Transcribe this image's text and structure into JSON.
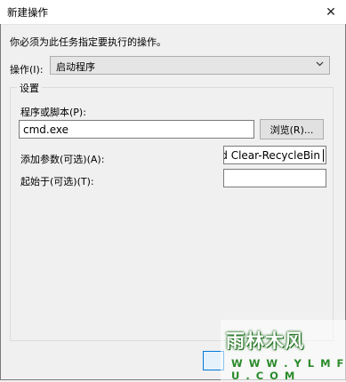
{
  "window": {
    "title": "新建操作",
    "close_glyph": "✕"
  },
  "instruction": "你必须为此任务指定要执行的操作。",
  "action": {
    "label": "操作(I):",
    "value": "启动程序"
  },
  "settings": {
    "group_title": "设置",
    "program_label": "程序或脚本(P):",
    "program_value": "cmd.exe",
    "browse_button": "浏览(R)...",
    "args_label": "添加参数(可选)(A):",
    "args_value": "and Clear-RecycleBin",
    "start_label": "起始于(可选)(T):",
    "start_value": ""
  },
  "watermark": {
    "name": "雨林木风",
    "url": "W W W . Y L M F U . C O M"
  },
  "colors": {
    "accent": "#0078d7",
    "watermark_green": "#2a8a2a"
  }
}
